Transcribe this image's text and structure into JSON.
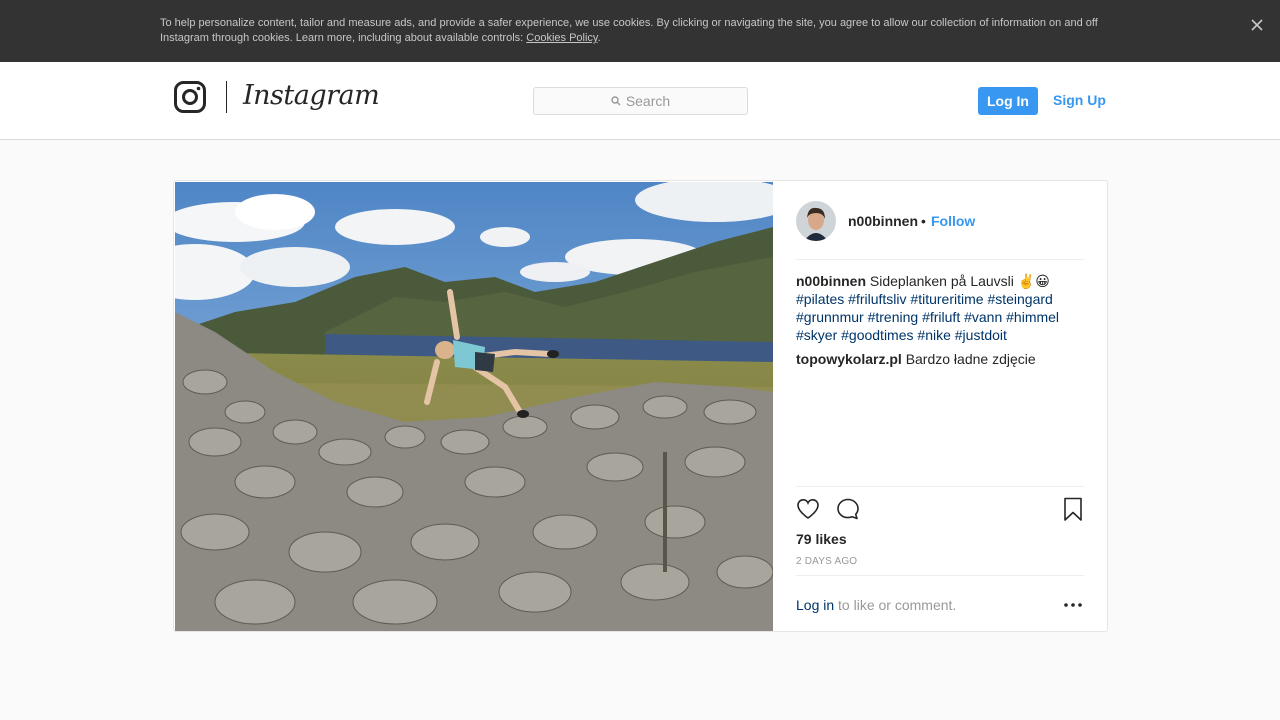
{
  "cookie_banner": {
    "text": "To help personalize content, tailor and measure ads, and provide a safer experience, we use cookies. By clicking or navigating the site, you agree to allow our collection of information on and off Instagram through cookies. Learn more, including about available controls: ",
    "link_label": "Cookies Policy",
    "end": ".",
    "close_icon": "close-icon"
  },
  "header": {
    "logo_icon": "instagram-camera-icon",
    "wordmark": "Instagram",
    "search_placeholder": "Search",
    "search_icon": "search-icon",
    "login_label": "Log In",
    "signup_label": "Sign Up"
  },
  "post": {
    "username": "n00binnen",
    "separator": "•",
    "follow_label": "Follow",
    "caption_user": "n00binnen",
    "caption_text": "Sideplanken på Lauvsli ✌️😀",
    "hashtags": [
      "#pilates",
      "#friluftsliv",
      "#titureritime",
      "#steingard",
      "#grunnmur",
      "#trening",
      "#friluft",
      "#vann",
      "#himmel",
      "#skyer",
      "#goodtimes",
      "#nike",
      "#justdoit"
    ],
    "comment": {
      "user": "topowykolarz.pl",
      "text": "Bardzo ładne zdjęcie"
    },
    "likes": "79 likes",
    "time_ago": "2 DAYS AGO",
    "login_link": "Log in",
    "login_suffix": " to like or comment.",
    "icons": [
      "heart-icon",
      "comment-icon",
      "bookmark-icon",
      "more-options-icon"
    ]
  },
  "colors": {
    "accent": "#3897f0",
    "hashtag": "#003569",
    "banner_bg": "#333333",
    "page_bg": "#fafafa"
  }
}
